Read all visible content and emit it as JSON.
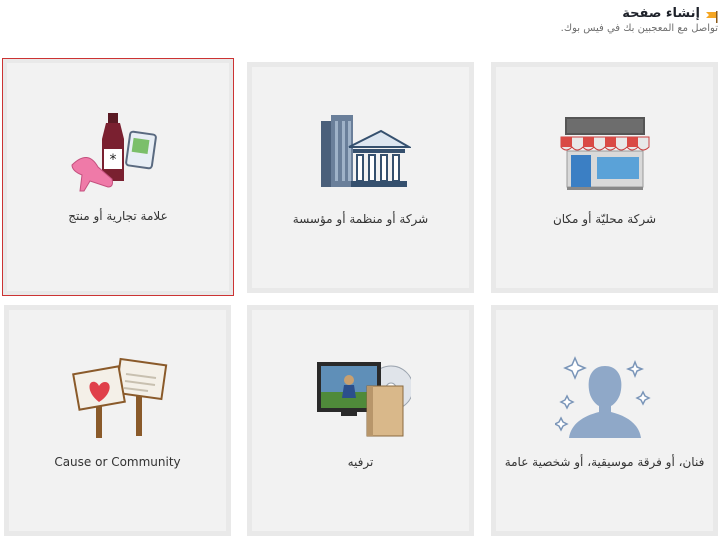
{
  "header": {
    "title": "إنشاء صفحة",
    "subtitle": "تواصل مع المعجبين بك في فيس بوك.",
    "icon": "orange-flag-icon"
  },
  "tiles": [
    {
      "label": "شركة محليّة أو مكان",
      "icon": "storefront-icon"
    },
    {
      "label": "شركة أو منظمة أو مؤسسة",
      "icon": "buildings-icon"
    },
    {
      "label": "علامة تجارية أو منتج",
      "icon": "products-icon"
    },
    {
      "label": "فنان، أو فرقة موسيقية، أو شخصية عامة",
      "icon": "person-silhouette-icon"
    },
    {
      "label": "ترفيه",
      "icon": "tv-book-dvd-icon"
    },
    {
      "label": "Cause or Community",
      "icon": "signs-heart-icon"
    }
  ],
  "colors": {
    "selected_border": "#cc3333",
    "tile_bg": "#f2f2f2",
    "tile_border": "#e9e9e9"
  }
}
